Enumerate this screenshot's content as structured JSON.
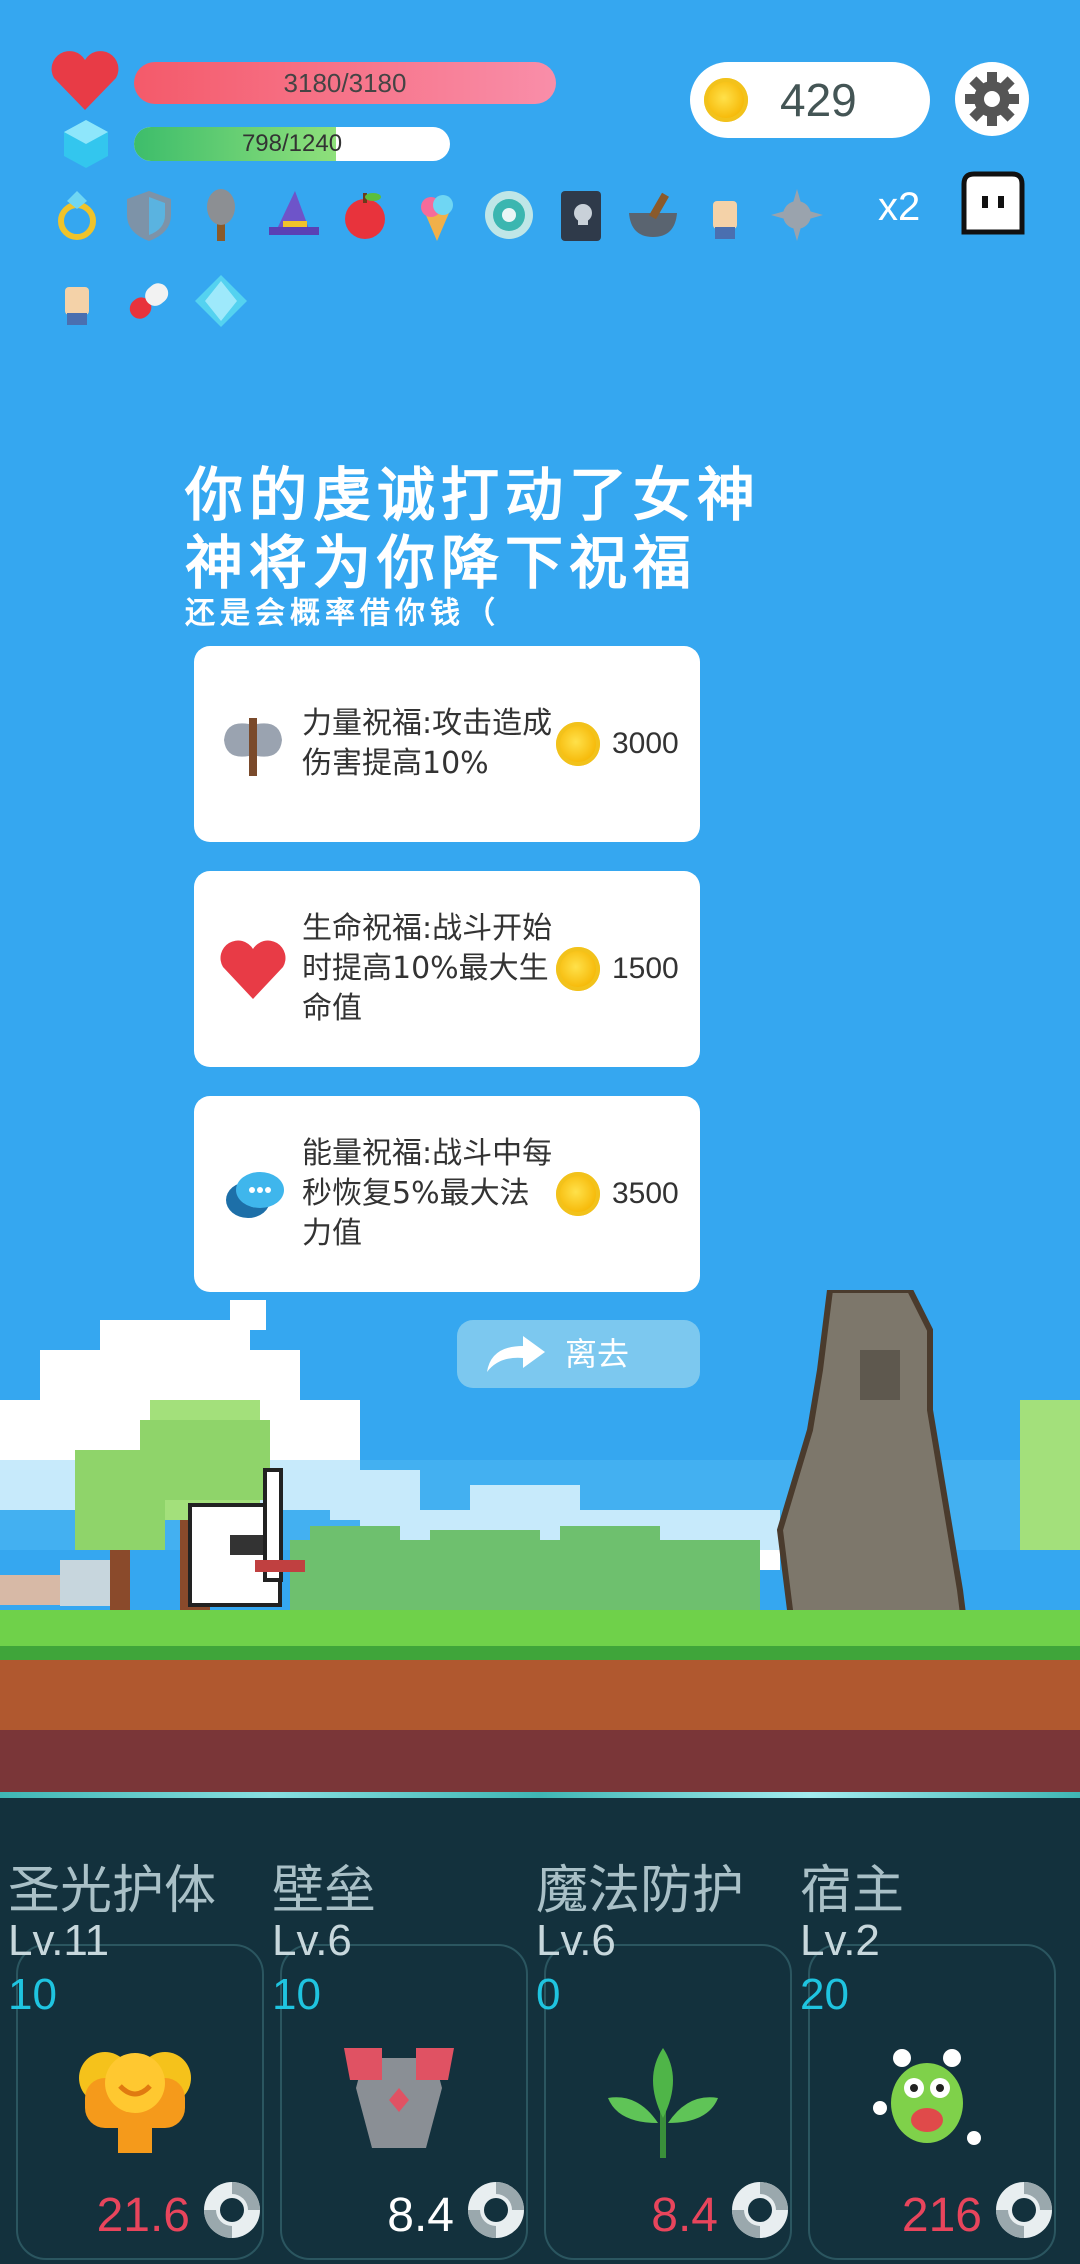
{
  "hud": {
    "hp_text": "3180/3180",
    "hp_fraction": 1.0,
    "mp_text": "798/1240",
    "mp_fraction": 0.64,
    "coins": "429",
    "multiplier": "x2",
    "item_icons": [
      "ring-icon",
      "shield-icon",
      "spiked-club-icon",
      "wizard-hat-icon",
      "apple-icon",
      "ice-cream-icon",
      "donut-icon",
      "skull-book-icon",
      "mortar-pestle-icon",
      "hand-icon",
      "spiked-ball-icon",
      "hand-icon",
      "pill-icon",
      "diamond-icon"
    ]
  },
  "message": {
    "line1": "你的虔诚打动了女神",
    "line2": "神将为你降下祝福",
    "line3": "还是会概率借你钱（"
  },
  "blessings": [
    {
      "icon": "axe-icon",
      "description": "力量祝福:攻击造成伤害提高10%",
      "price": "3000"
    },
    {
      "icon": "heart-icon",
      "description": "生命祝福:战斗开始时提高10%最大生命值",
      "price": "1500"
    },
    {
      "icon": "chat-bubble-icon",
      "description": "能量祝福:战斗中每秒恢复5%最大法力值",
      "price": "3500"
    }
  ],
  "leave_label": "离去",
  "skills": [
    {
      "name": "圣光护体",
      "level": "Lv.11",
      "cost": "10",
      "value": "21.6",
      "value_color": "#e8455c",
      "icon": "holy-shield-icon"
    },
    {
      "name": "壁垒",
      "level": "Lv.6",
      "cost": "10",
      "value": "8.4",
      "value_color": "#ffffff",
      "icon": "armor-icon"
    },
    {
      "name": "魔法防护",
      "level": "Lv.6",
      "cost": "0",
      "value": "8.4",
      "value_color": "#e8455c",
      "icon": "leaf-icon"
    },
    {
      "name": "宿主",
      "level": "Lv.2",
      "cost": "20",
      "value": "216",
      "value_color": "#e8455c",
      "icon": "monster-icon"
    }
  ],
  "colors": {
    "sky": "#35a7f0",
    "grass": "#6fd14a",
    "dirt": "#b0582f",
    "panel": "#13313d"
  }
}
